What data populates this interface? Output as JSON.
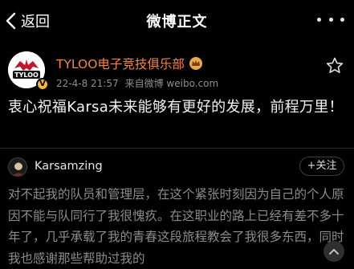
{
  "navbar": {
    "back_label": "返回",
    "title": "微博正文"
  },
  "post": {
    "author": "TYLOO电子竞技俱乐部",
    "date": "22-4-8 21:57",
    "source": "来自微博 weibo.com",
    "text": "衷心祝福Karsa未来能够有更好的发展，前程万里！"
  },
  "repost": {
    "author": "Karsamzing",
    "follow_label": "+关注",
    "text": "对不起我的队员和管理层，在这个紧张时刻因为自己的个人原因不能与队同行了我很愧疚。在这职业的路上已经有差不多十年了，几乎承载了我的青春这段旅程教会了我很多东西，同时我也感谢那些帮助过我的"
  },
  "colors": {
    "background": "#000000",
    "author_name": "#f6843f",
    "meta": "#8f8f8f",
    "repost_text": "#8c8c8c"
  }
}
